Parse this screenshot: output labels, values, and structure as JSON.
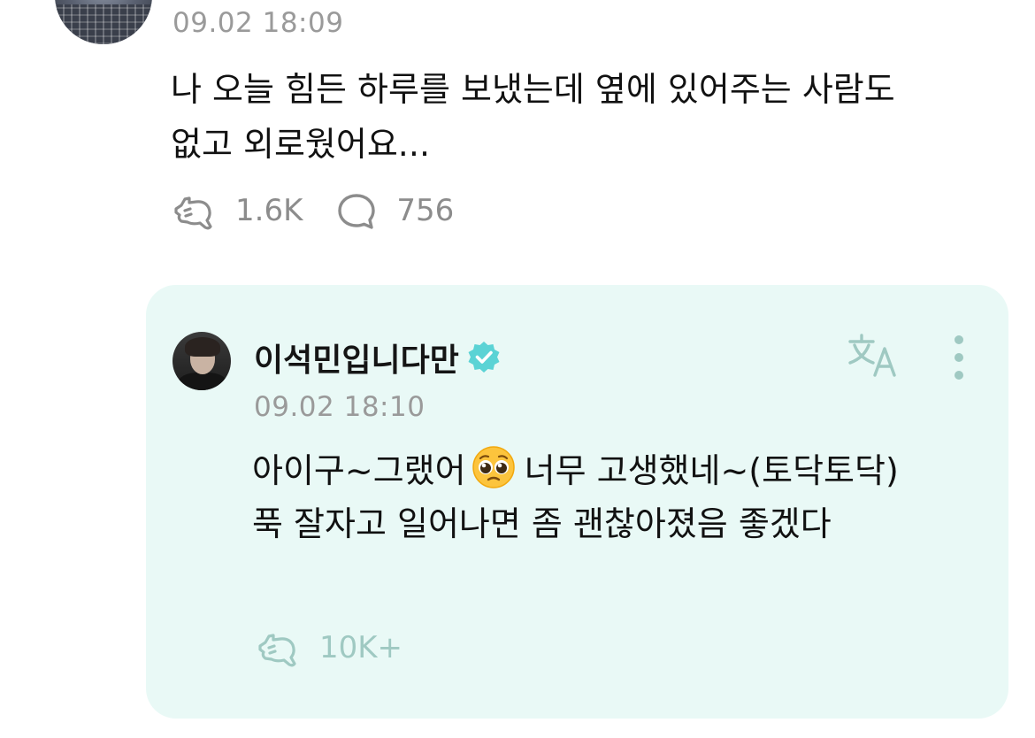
{
  "post": {
    "timestamp": "09.02 18:09",
    "text_line1": "나 오늘 힘든 하루를 보냈는데 옆에 있어주는 사람도",
    "text_line2": "없고 외로웠어요...",
    "likes": "1.6K",
    "comments": "756",
    "like_icon": "fist-bump-icon",
    "comment_icon": "speech-bubble-icon"
  },
  "reply": {
    "author": "이석민입니다만",
    "verified_icon": "verified-badge-icon",
    "verified_color": "#5bd3d5",
    "timestamp": "09.02 18:10",
    "text_part1": "아이구~그랬어",
    "emoji_icon": "pleading-face-emoji",
    "text_part2": "너무 고생했네~(토닥토닥)",
    "text_line2": "푹 잘자고 일어나면 좀 괜찮아졌음 좋겠다",
    "likes": "10K+",
    "translate_icon": "translate-icon",
    "more_icon": "more-vertical-icon",
    "background_color": "#e9f9f6",
    "icon_color": "#9fc9c2"
  }
}
